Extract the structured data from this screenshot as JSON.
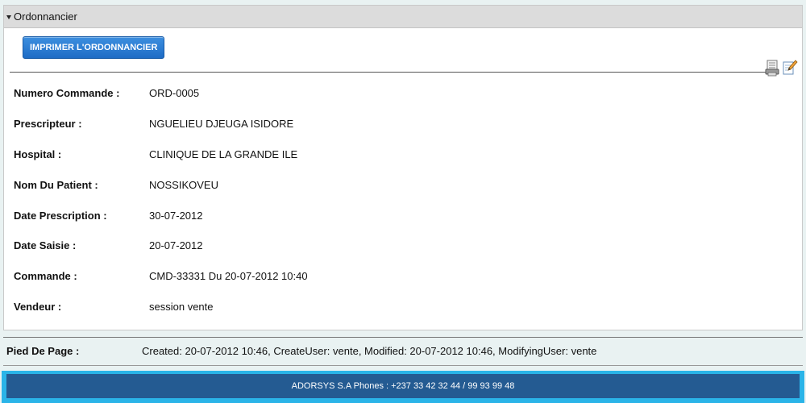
{
  "panel": {
    "title": "Ordonnancier",
    "print_button": "IMPRIMER L'ORDONNANCIER",
    "icons": [
      "print-list-icon",
      "edit-icon"
    ]
  },
  "fields": [
    {
      "label": "Numero Commande :",
      "value": "ORD-0005"
    },
    {
      "label": "Prescripteur :",
      "value": "NGUELIEU DJEUGA ISIDORE"
    },
    {
      "label": "Hospital :",
      "value": "CLINIQUE DE LA GRANDE ILE"
    },
    {
      "label": "Nom Du Patient :",
      "value": "NOSSIKOVEU"
    },
    {
      "label": "Date Prescription :",
      "value": "30-07-2012"
    },
    {
      "label": "Date Saisie :",
      "value": "20-07-2012"
    },
    {
      "label": "Commande :",
      "value": "CMD-33331 Du 20-07-2012 10:40"
    },
    {
      "label": "Vendeur :",
      "value": "session vente"
    }
  ],
  "footer": {
    "label": "Pied De Page :",
    "value": "Created: 20-07-2012 10:46, CreateUser: vente, Modified: 20-07-2012 10:46, ModifyingUser: vente"
  },
  "bottom_bar": {
    "text": "ADORSYS S.A Phones : +237 33 42 32 44 / 99 93 99 48"
  },
  "colors": {
    "button_blue": "#1e6cc5",
    "bottom_bar_outer": "#2ab4e8",
    "bottom_bar_inner": "#245b92",
    "header_gray": "#dcdcdc"
  }
}
